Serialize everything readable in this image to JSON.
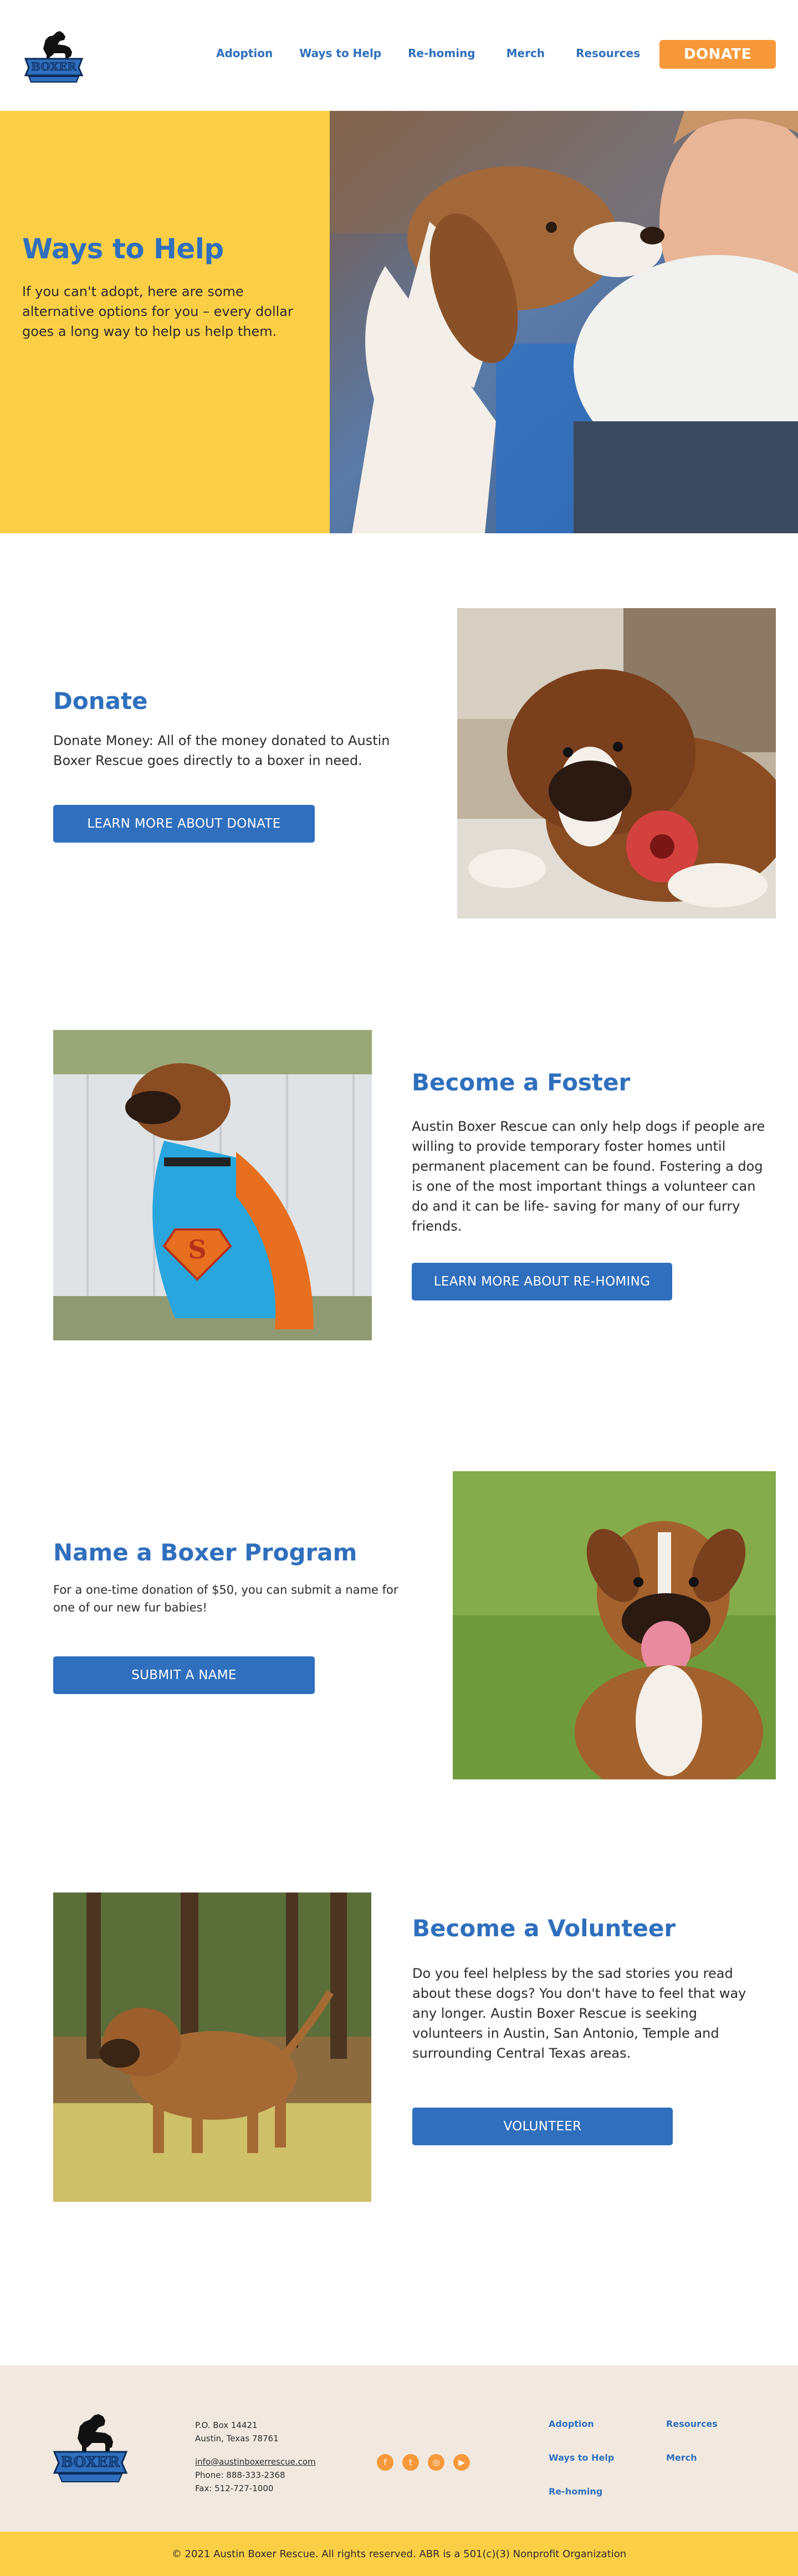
{
  "header": {
    "logo_alt": "Austin Boxer Rescue",
    "nav": [
      "Adoption",
      "Ways to Help",
      "Re-homing",
      "Merch",
      "Resources"
    ],
    "donate_label": "DONATE"
  },
  "hero": {
    "title": "Ways to Help",
    "description": "If you can't adopt, here are some alternative options for you – every dollar goes a long way to help us help them."
  },
  "sections": {
    "donate": {
      "title": "Donate",
      "text": "Donate Money: All of the money donated to Austin Boxer Rescue goes directly to a boxer in need.",
      "button": "LEARN MORE ABOUT DONATE"
    },
    "foster": {
      "title": "Become a Foster",
      "text": "Austin Boxer Rescue can only help dogs if people are willing to provide temporary foster homes until permanent placement can be found. Fostering a dog is one of the most important things a volunteer can do and it can be life- saving for many of our furry friends.",
      "button": "LEARN MORE ABOUT RE-HOMING"
    },
    "name_program": {
      "title": "Name a Boxer Program",
      "text": "For a one-time donation of $50, you can submit a name for one of our new fur babies!",
      "button": "SUBMIT A NAME"
    },
    "volunteer": {
      "title": "Become a Volunteer",
      "text": "Do you feel helpless by the sad stories you read about these dogs? You don't have to feel that way any longer. Austin Boxer Rescue is seeking volunteers in Austin, San Antonio, Temple and surrounding Central Texas areas.",
      "button": "VOLUNTEER"
    }
  },
  "footer": {
    "address_line1": "P.O. Box 14421",
    "address_line2": "Austin, Texas 78761",
    "email": "info@austinboxerrescue.com",
    "phone": "Phone: 888-333-2368",
    "fax": "Fax: 512-727-1000",
    "social_icons": [
      "facebook-icon",
      "twitter-icon",
      "instagram-icon",
      "youtube-icon"
    ],
    "links": [
      "Adoption",
      "Resources",
      "Ways to Help",
      "Merch",
      "Re-homing"
    ],
    "copyright": "© 2021 Austin Boxer Rescue. All rights reserved. ABR is a 501(c)(3) Nonprofit Organization"
  },
  "colors": {
    "brand_blue": "#2f6fbd",
    "accent_orange": "#f7993a",
    "brand_yellow": "#fbcf45",
    "footer_beige": "#f1e9df"
  }
}
